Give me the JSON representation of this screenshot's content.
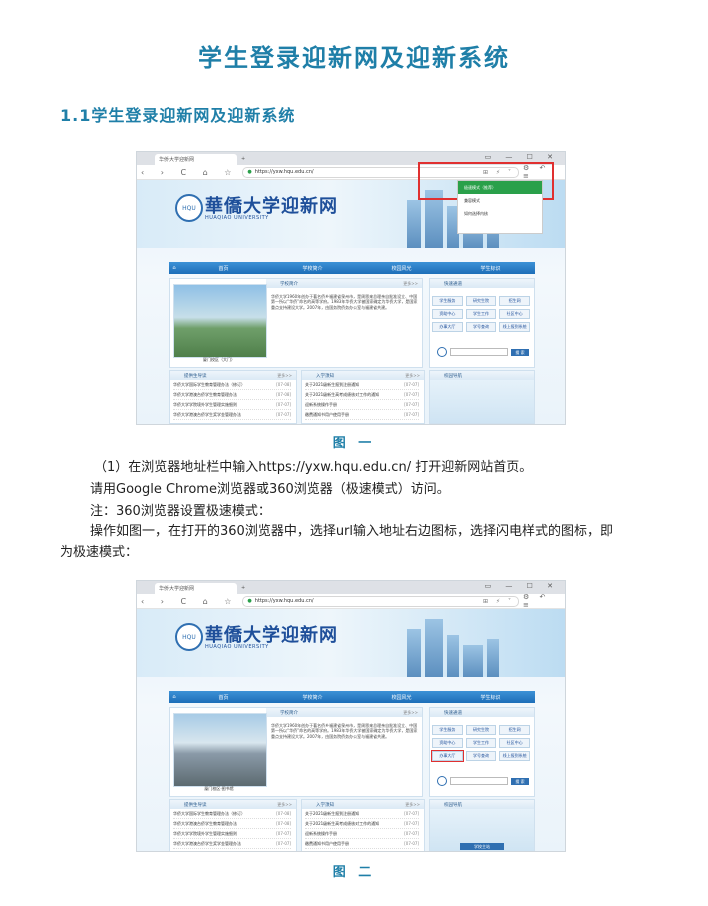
{
  "title": "学生登录迎新网及迎新系统",
  "section_heading": "1.1学生登录迎新网及迎新系统",
  "figure1_caption": "图 一",
  "figure2_caption": "图 二",
  "paragraphs": [
    "（1）在浏览器地址栏中输入https://yxw.hqu.edu.cn/ 打开迎新网站首页。",
    "请用Google Chrome浏览器或360浏览器（极速模式）访问。",
    "注：360浏览器设置极速模式：",
    "操作如图一，在打开的360浏览器中，选择url输入地址右边图标，选择闪电样式的图标，即",
    "为极速模式："
  ],
  "browser": {
    "tab_title": "华侨大学迎新网",
    "url": "https://yxw.hqu.edu.cn/",
    "nav_symbols": "‹ › C ⌂ ☆",
    "window_controls": "▭ — ☐ ✕",
    "right_tools": "⚙ ↶ ≡",
    "addr_icons": "⊞ ⚡ ˅"
  },
  "popup": {
    "items": [
      "极速模式（推荐）",
      "兼容模式",
      "如何选择内核"
    ]
  },
  "site": {
    "logo_seal": "HQU",
    "logo_cn": "華僑大学迎新网",
    "logo_en": "HUAQIAO UNIVERSITY",
    "nav": [
      "首页",
      "学校简介",
      "校园风光",
      "学生标识"
    ],
    "intro_head": "学校简介",
    "intro_head_more": "更多>>",
    "intro_text": "华侨大学1960年创办于著名侨乡福建省泉州市，是周恩来总理亲自批准设立、中国第一所以“华侨”命名的高等学府。1983年华侨大学被国家确定为华侨大学，是国家重点支持建设大学。2007年，由国务院侨务办公室与福建省共建。",
    "photo_caption_1": "厦门校区（大门）",
    "photo_caption_2": "厦门校区·图书馆",
    "quick_head": "快速通道",
    "quick_buttons": [
      "学生服务",
      "研究生院",
      "招生网",
      "资助中心",
      "学生工作",
      "社区中心",
      "办事大厅",
      "学号查询",
      "线上报到系统"
    ],
    "search_btn": "搜 索",
    "rookie_head": "校园导航",
    "campus_map": "学校主站",
    "news1_head": "提供生导读",
    "news2_head": "入学须知",
    "more": "更多>>",
    "news1": [
      [
        "华侨大学国际学生教育管理办法（修订）",
        "[07-08]"
      ],
      [
        "华侨大学港澳台侨学生教育管理办法",
        "[07-08]"
      ],
      [
        "华侨大学学院境外学生管理实施细则",
        "[07-07]"
      ],
      [
        "华侨大学港澳台侨学生奖学金管理办法",
        "[07-07]"
      ],
      [
        "华侨大学本科学生学籍管理规定",
        "[07-07]"
      ]
    ],
    "news2": [
      [
        "关于2021级新生报到注册通知",
        "[07-07]"
      ],
      [
        "关于2021级新生高考成绩核对工作的通知",
        "[07-07]"
      ],
      [
        "迎新系统操作手册",
        "[07-07]"
      ],
      [
        "缴费通知书用户使用手册",
        "[07-07]"
      ],
      [
        "关于2021级港澳台侨学生入学须知",
        "[07-07]"
      ]
    ]
  }
}
